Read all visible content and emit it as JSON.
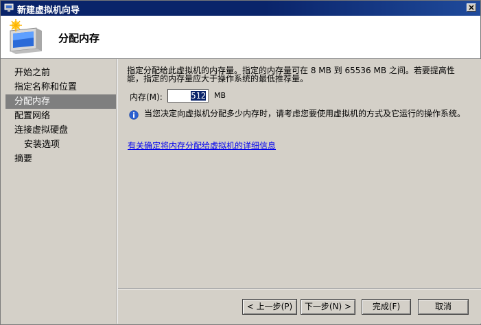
{
  "window": {
    "title": "新建虚拟机向导"
  },
  "header": {
    "title": "分配内存"
  },
  "nav": {
    "items": [
      {
        "label": "开始之前"
      },
      {
        "label": "指定名称和位置"
      },
      {
        "label": "分配内存"
      },
      {
        "label": "配置网络"
      },
      {
        "label": "连接虚拟硬盘"
      },
      {
        "label": "安装选项"
      },
      {
        "label": "摘要"
      }
    ],
    "selected": "分配内存"
  },
  "content": {
    "description": "指定分配给此虚拟机的内存量。指定的内存量可在 8 MB 到 65536 MB 之间。若要提高性能，指定的内存量应大于操作系统的最低推荐量。",
    "memory_label": "内存(M):",
    "memory_value": "512",
    "memory_unit": "MB",
    "info_text": "当您决定向虚拟机分配多少内存时，请考虑您要使用虚拟机的方式及它运行的操作系统。",
    "link_text": "有关确定将内存分配给虚拟机的详细信息"
  },
  "buttons": {
    "back": "< 上一步(P)",
    "next": "下一步(N) >",
    "finish": "完成(F)",
    "cancel": "取消"
  },
  "colors": {
    "titlebar": "#0a246a",
    "selected_nav": "#7f7f7f",
    "link": "#0000ee",
    "dialog_bg": "#d4d0c8"
  }
}
